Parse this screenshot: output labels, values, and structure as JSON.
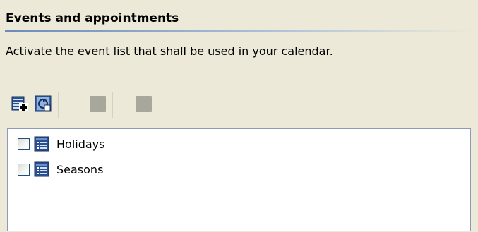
{
  "section": {
    "title": "Events and appointments",
    "description": "Activate the event list that shall be used in your calendar."
  },
  "toolbar": {
    "buttons": [
      {
        "icon": "add-list-icon",
        "enabled": true
      },
      {
        "icon": "import-list-icon",
        "enabled": true
      },
      {
        "icon": "edit-list-icon",
        "enabled": false
      },
      {
        "icon": "delete-list-icon",
        "enabled": false
      }
    ]
  },
  "event_lists": [
    {
      "label": "Holidays",
      "checked": false,
      "icon": "calendar-list-icon"
    },
    {
      "label": "Seasons",
      "checked": false,
      "icon": "calendar-list-icon"
    }
  ]
}
